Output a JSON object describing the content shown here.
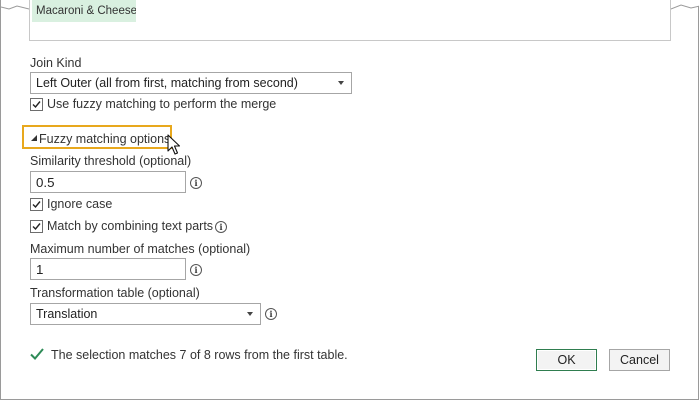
{
  "preview": {
    "cell_text": "Macaroni & Cheese"
  },
  "join_kind": {
    "label": "Join Kind",
    "selected": "Left Outer (all from first, matching from second)"
  },
  "fuzzy_checkbox": {
    "label": "Use fuzzy matching to perform the merge",
    "checked": true
  },
  "fuzzy_options": {
    "toggle_label": "Fuzzy matching options",
    "similarity_label": "Similarity threshold (optional)",
    "similarity_value": "0.5",
    "ignore_case_label": "Ignore case",
    "ignore_case_checked": true,
    "combine_parts_label": "Match by combining text parts",
    "combine_parts_checked": true,
    "max_matches_label": "Maximum number of matches (optional)",
    "max_matches_value": "1",
    "transformation_label": "Transformation table (optional)",
    "transformation_selected": "Translation"
  },
  "status": {
    "text": "The selection matches 7 of 8 rows from the first table."
  },
  "buttons": {
    "ok": "OK",
    "cancel": "Cancel"
  },
  "colors": {
    "highlight": "#e8a81d",
    "check_green": "#2e8b57",
    "ok_border": "#2f7d4f"
  },
  "icons": {
    "info": "info-icon",
    "check": "checkmark-icon",
    "cursor": "mouse-pointer-icon"
  }
}
